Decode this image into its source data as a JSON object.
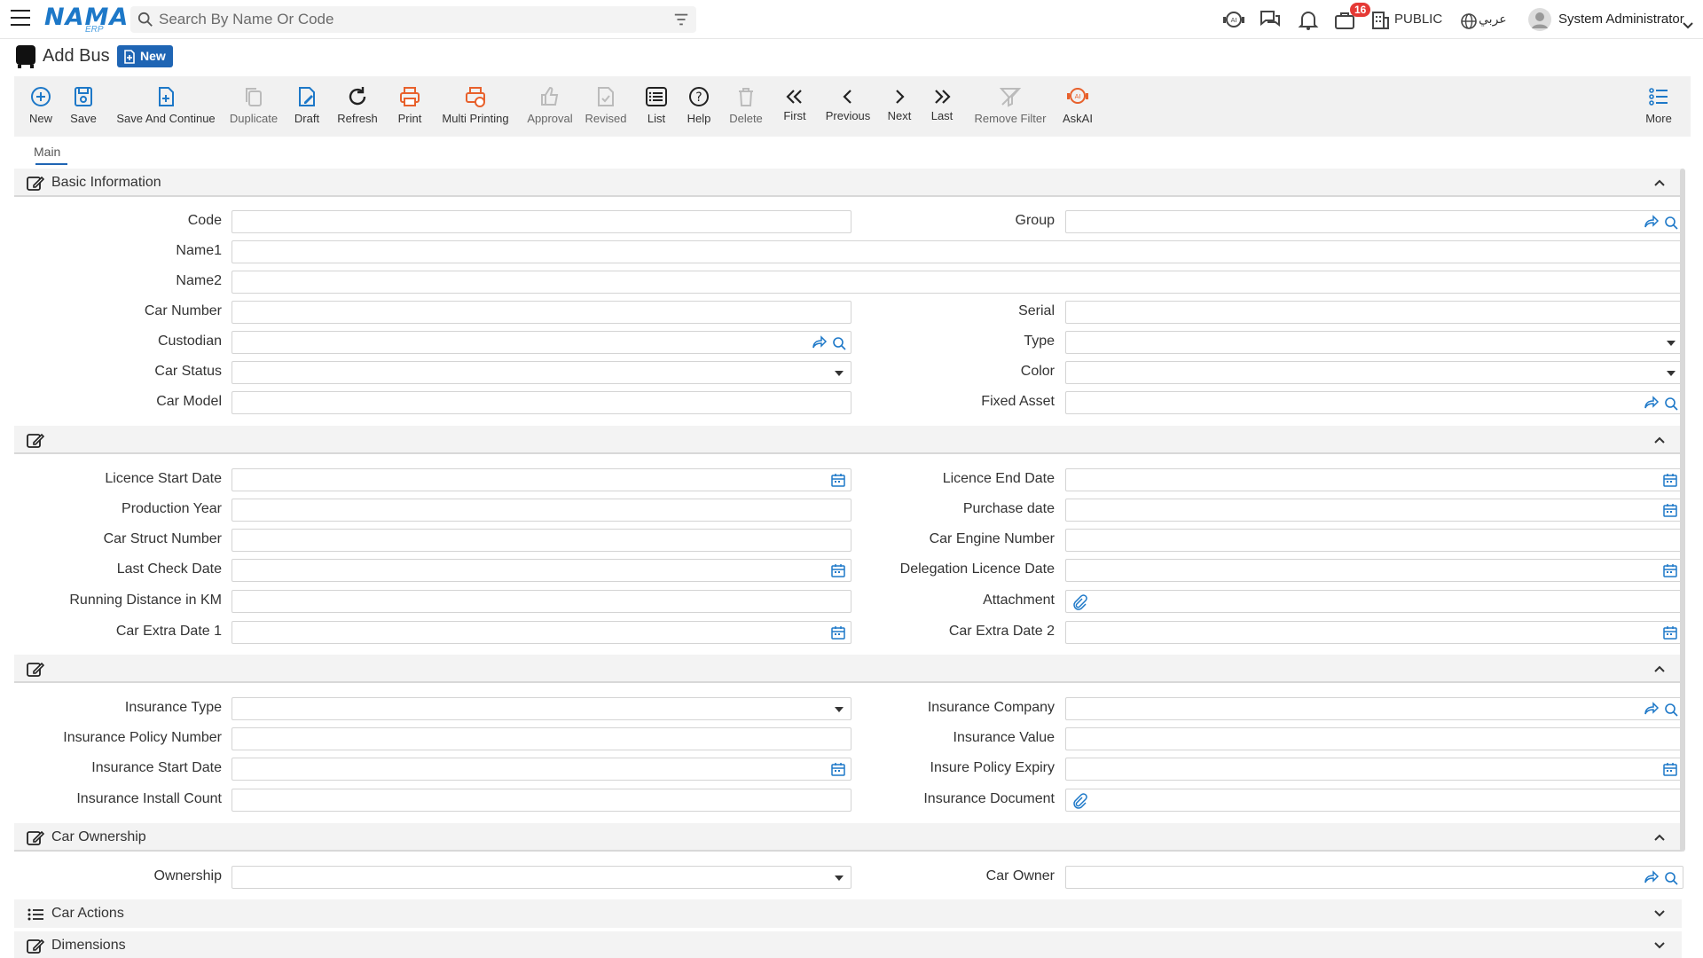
{
  "app": {
    "logo_text": "NAMA",
    "logo_sub": "ERP",
    "search_placeholder": "Search By Name Or Code",
    "notification_count": "16",
    "branch": "PUBLIC",
    "language": "عربي",
    "user": "System Administrator"
  },
  "page": {
    "title": "Add Bus",
    "status_badge": "New"
  },
  "toolbar": {
    "new": "New",
    "save": "Save",
    "save_continue": "Save And Continue",
    "duplicate": "Duplicate",
    "draft": "Draft",
    "refresh": "Refresh",
    "print": "Print",
    "multi_printing": "Multi Printing",
    "approval": "Approval",
    "revised": "Revised",
    "list": "List",
    "help": "Help",
    "delete": "Delete",
    "first": "First",
    "previous": "Previous",
    "next": "Next",
    "last": "Last",
    "remove_filter": "Remove Filter",
    "askai": "AskAI",
    "more": "More"
  },
  "tabs": {
    "main": "Main"
  },
  "sections": {
    "basic": "Basic Information",
    "licence": "",
    "insurance": "",
    "ownership": "Car Ownership",
    "actions": "Car Actions",
    "dimensions": "Dimensions"
  },
  "fields": {
    "code": "Code",
    "group": "Group",
    "name1": "Name1",
    "name2": "Name2",
    "car_number": "Car Number",
    "serial": "Serial",
    "custodian": "Custodian",
    "type": "Type",
    "car_status": "Car Status",
    "color": "Color",
    "car_model": "Car Model",
    "fixed_asset": "Fixed Asset",
    "licence_start": "Licence Start Date",
    "licence_end": "Licence End Date",
    "production_year": "Production Year",
    "purchase_date": "Purchase date",
    "car_struct": "Car Struct Number",
    "car_engine": "Car Engine Number",
    "last_check": "Last Check Date",
    "delegation_licence": "Delegation Licence Date",
    "running_distance": "Running Distance in KM",
    "attachment": "Attachment",
    "extra_date1": "Car Extra Date 1",
    "extra_date2": "Car Extra Date 2",
    "insurance_type": "Insurance Type",
    "insurance_company": "Insurance Company",
    "insurance_policy_number": "Insurance Policy Number",
    "insurance_value": "Insurance Value",
    "insurance_start": "Insurance Start Date",
    "insure_policy_expiry": "Insure Policy Expiry",
    "insurance_install_count": "Insurance Install Count",
    "insurance_document": "Insurance Document",
    "ownership": "Ownership",
    "car_owner": "Car Owner"
  },
  "colors": {
    "accent": "#1f65b4",
    "icon_blue": "#1d78c8",
    "icon_orange": "#e8612c",
    "badge_red": "#e53935"
  }
}
